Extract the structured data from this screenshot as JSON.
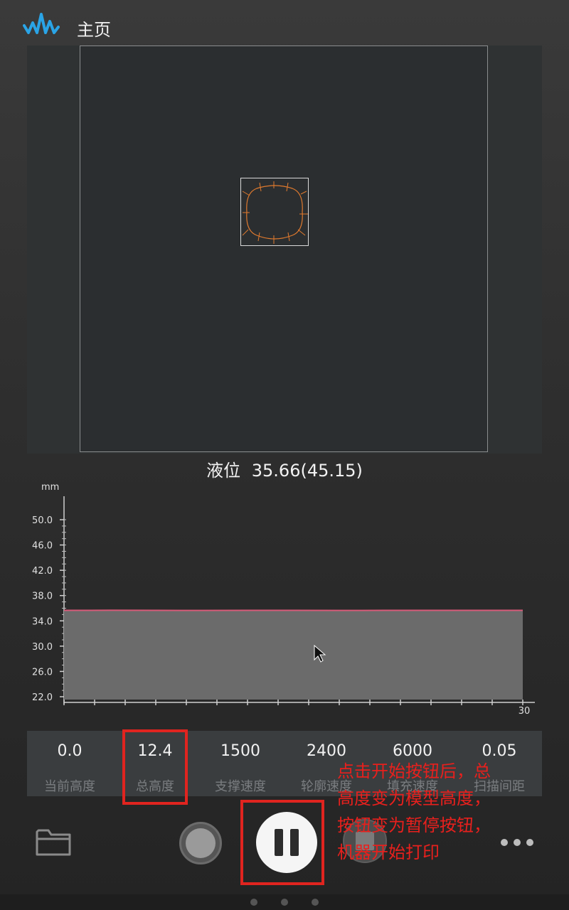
{
  "header": {
    "title": "主页",
    "logo_icon": "waveform-logo-icon"
  },
  "preview": {
    "model_color": "#e07a2e"
  },
  "level": {
    "label": "液位",
    "value": "35.66(45.15)"
  },
  "chart_data": {
    "type": "area",
    "ylabel": "mm",
    "xlabel": "",
    "yticks": [
      "50.0",
      "46.0",
      "42.0",
      "38.0",
      "34.0",
      "30.0",
      "26.0",
      "22.0"
    ],
    "ylim": [
      22.0,
      50.0
    ],
    "xlim": [
      0,
      30
    ],
    "xtick_labels": [
      "30"
    ],
    "series": [
      {
        "x": [
          0,
          3,
          6,
          9,
          12,
          15,
          18,
          21,
          24,
          27,
          30
        ],
        "values": [
          35.66,
          35.67,
          35.66,
          35.65,
          35.66,
          35.66,
          35.65,
          35.66,
          35.66,
          35.66,
          35.66
        ]
      }
    ],
    "fill_color": "#6b6b6b",
    "line_color": "#d85a78",
    "grid": false
  },
  "stats": [
    {
      "value": "0.0",
      "label": "当前高度"
    },
    {
      "value": "12.4",
      "label": "总高度"
    },
    {
      "value": "1500",
      "label": "支撑速度"
    },
    {
      "value": "2400",
      "label": "轮廓速度"
    },
    {
      "value": "6000",
      "label": "填充速度"
    },
    {
      "value": "0.05",
      "label": "扫描间距"
    }
  ],
  "toolbar": {
    "folder_icon": "folder-icon",
    "record_icon": "record-icon",
    "pause_icon": "pause-icon",
    "stop_icon": "stop-icon",
    "more_icon": "more-dots-icon"
  },
  "annotation": {
    "lines": [
      "点击开始按钮后，总",
      "高度变为模型高度，",
      "按钮变为暂停按钮，",
      "机器开始打印"
    ],
    "color": "#e8201d"
  }
}
